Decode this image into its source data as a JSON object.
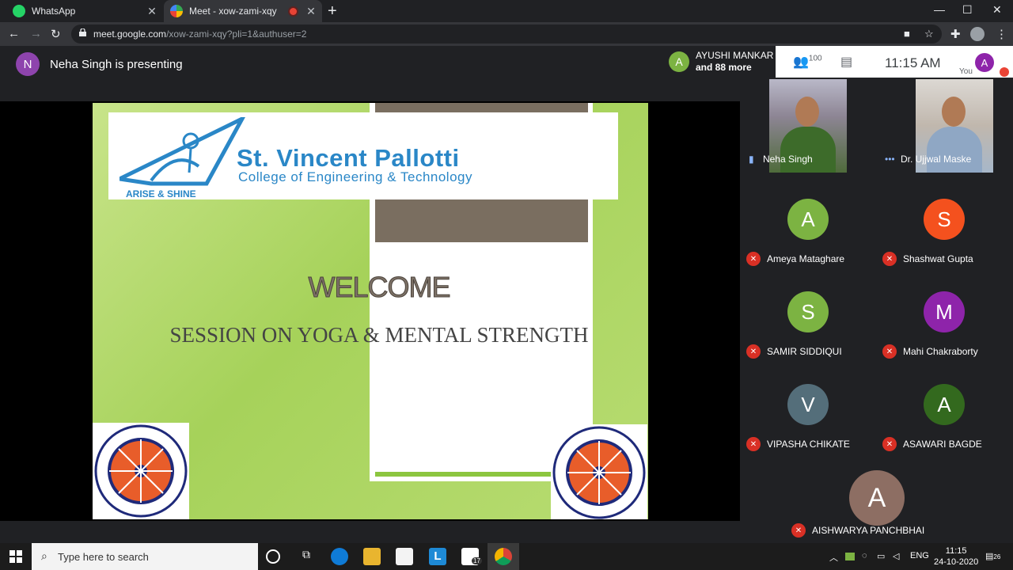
{
  "browser": {
    "tabs": [
      {
        "label": "WhatsApp",
        "active": false
      },
      {
        "label": "Meet - xow-zami-xqy",
        "active": true
      }
    ],
    "url_domain": "meet.google.com",
    "url_path": "/xow-zami-xqy?pli=1&authuser=2"
  },
  "meet": {
    "presenter_initial": "N",
    "presenter_text": "Neha Singh is presenting",
    "participants_avatar": "A",
    "participants_line1": "AYUSHI MANKAR",
    "participants_line2": "and 88 more",
    "people_count": "100",
    "time": "11:15  AM",
    "you_initial": "A",
    "you_label": "You"
  },
  "slide": {
    "college_name": "St. Vincent Pallotti",
    "college_sub": "College of Engineering & Technology",
    "motto": "ARISE & SHINE",
    "welcome": "WELCOME",
    "session": "SESSION ON YOGA & MENTAL STRENGTH"
  },
  "videos": [
    {
      "name": "Neha Singh"
    },
    {
      "name": "Dr. Ujjwal Maske"
    }
  ],
  "tiles": [
    {
      "initial": "A",
      "name": "Ameya Mataghare",
      "color": "#7cb342"
    },
    {
      "initial": "S",
      "name": "Shashwat Gupta",
      "color": "#f4511e"
    },
    {
      "initial": "S",
      "name": "SAMIR SIDDIQUI",
      "color": "#7cb342"
    },
    {
      "initial": "M",
      "name": "Mahi Chakraborty",
      "color": "#8e24aa"
    },
    {
      "initial": "V",
      "name": "VIPASHA CHIKATE",
      "color": "#546e7a"
    },
    {
      "initial": "A",
      "name": "ASAWARI BAGDE",
      "color": "#33691e"
    },
    {
      "initial": "A",
      "name": "AISHWARYA PANCHBHAI",
      "color": "#8d6e63"
    }
  ],
  "taskbar": {
    "search_placeholder": "Type here to search",
    "lang": "ENG",
    "clock_time": "11:15",
    "clock_date": "24-10-2020",
    "notif_count": "26",
    "mail_badge": "17"
  }
}
